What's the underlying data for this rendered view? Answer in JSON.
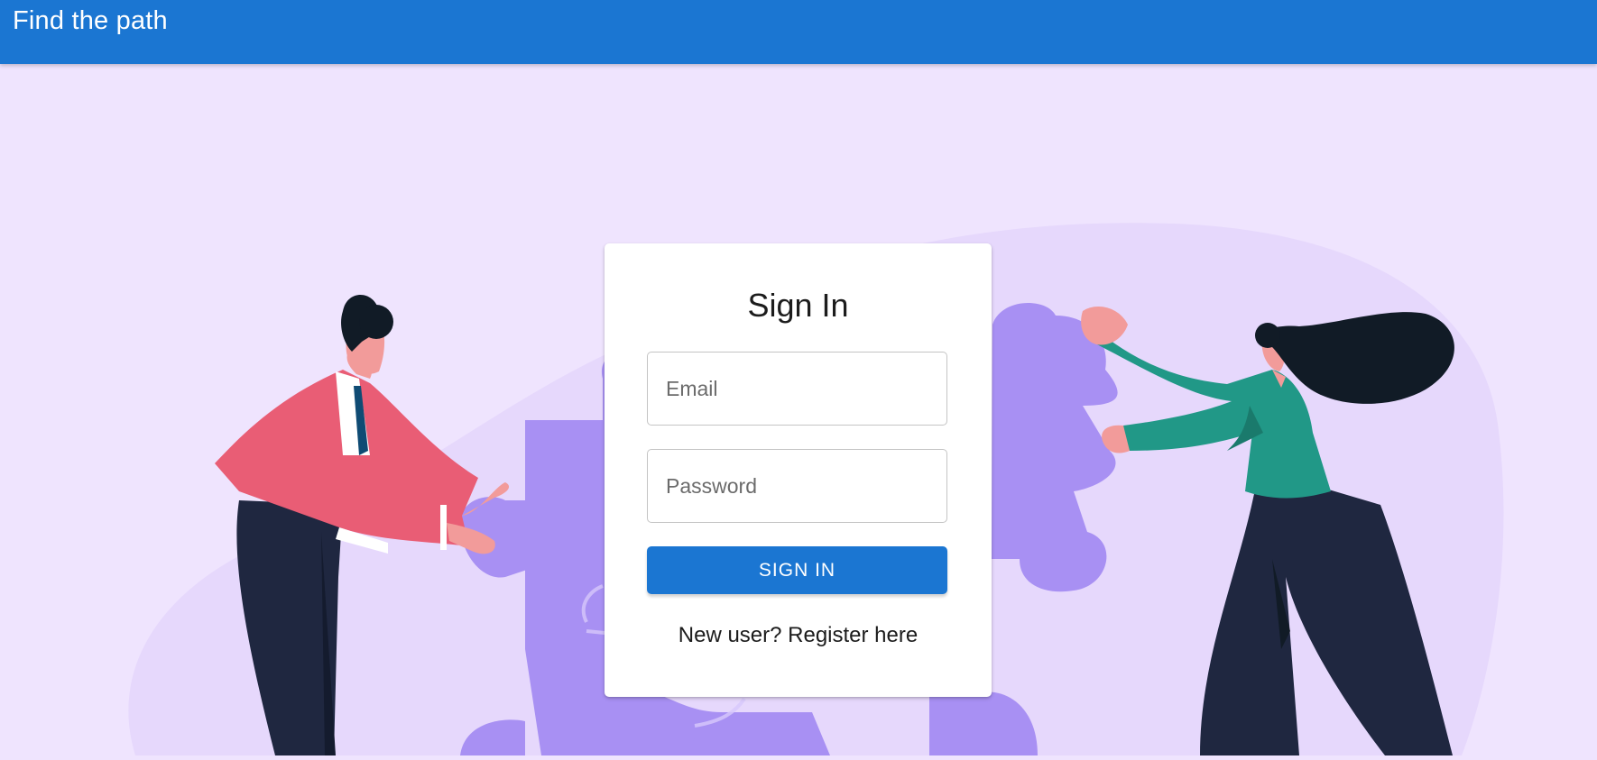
{
  "header": {
    "title": "Find the path"
  },
  "signin": {
    "title": "Sign In",
    "email_placeholder": "Email",
    "password_placeholder": "Password",
    "button_label": "SIGN IN",
    "register_text": "New user? Register here"
  },
  "illustration": {
    "subject": "two people assembling puzzle pieces"
  },
  "colors": {
    "appbar": "#1b76d2",
    "background": "#efe4fe",
    "blob": "#e6d8fc",
    "puzzle": "#a890f3",
    "man_shirt": "#e95d75",
    "woman_shirt": "#219887",
    "pants": "#1f2740",
    "hair": "#111b26",
    "skin": "#f29b9a"
  }
}
